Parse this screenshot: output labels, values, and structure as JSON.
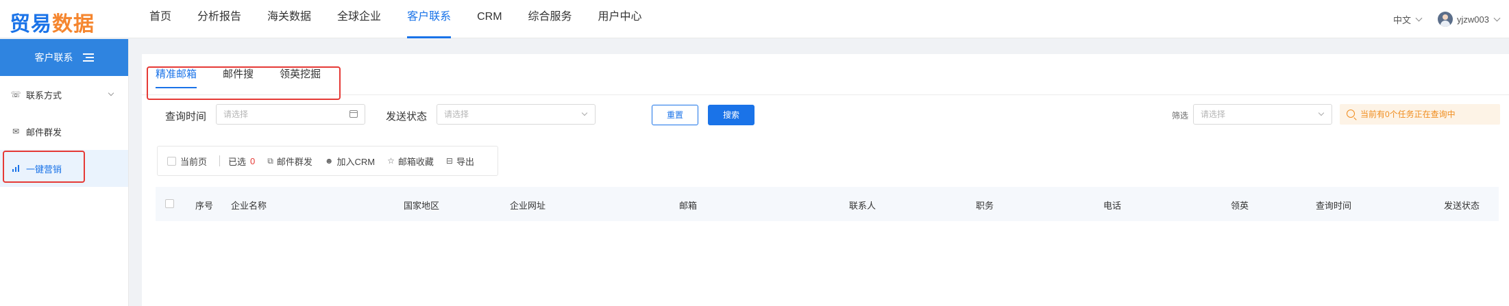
{
  "logo": {
    "part1": "贸易",
    "part2": "数据"
  },
  "nav": {
    "items": [
      {
        "label": "首页",
        "active": false
      },
      {
        "label": "分析报告",
        "active": false
      },
      {
        "label": "海关数据",
        "active": false
      },
      {
        "label": "全球企业",
        "active": false
      },
      {
        "label": "客户联系",
        "active": true
      },
      {
        "label": "CRM",
        "active": false
      },
      {
        "label": "综合服务",
        "active": false
      },
      {
        "label": "用户中心",
        "active": false
      }
    ]
  },
  "topright": {
    "language": "中文",
    "username": "yjzw003"
  },
  "sidebar": {
    "title": "客户联系",
    "items": [
      {
        "label": "联系方式",
        "icon": "phone-icon"
      },
      {
        "label": "邮件群发",
        "icon": "mail-icon"
      },
      {
        "label": "一键营销",
        "icon": "bar-chart-icon"
      }
    ]
  },
  "tabs": [
    {
      "label": "精准邮箱",
      "active": true
    },
    {
      "label": "邮件搜",
      "active": false
    },
    {
      "label": "领英挖掘",
      "active": false
    }
  ],
  "filters": {
    "query_time_label": "查询时间",
    "query_time_placeholder": "请选择",
    "send_status_label": "发送状态",
    "send_status_placeholder": "请选择",
    "reset_button": "重置",
    "search_button": "搜索",
    "filter_label": "筛选",
    "filter_placeholder": "请选择",
    "notice": "当前有0个任务正在查询中"
  },
  "toolbar": {
    "current_page": "当前页",
    "selected_label": "已选",
    "selected_count": "0",
    "mass_mail": "邮件群发",
    "add_crm": "加入CRM",
    "favorite": "邮箱收藏",
    "export": "导出"
  },
  "table": {
    "columns": [
      "序号",
      "企业名称",
      "国家地区",
      "企业网址",
      "邮箱",
      "联系人",
      "职务",
      "电话",
      "领英",
      "查询时间",
      "发送状态"
    ]
  },
  "colors": {
    "accent": "#1a73e8",
    "logo_orange": "#f5862f",
    "highlight_red": "#e53935",
    "notice_orange": "#f08c1d"
  }
}
